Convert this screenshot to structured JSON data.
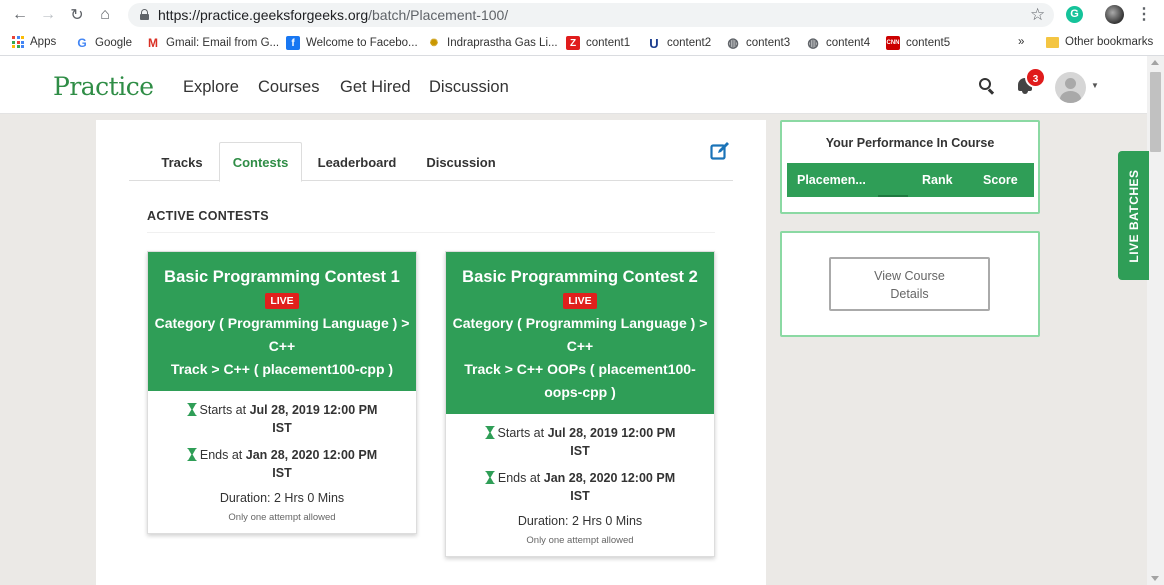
{
  "browser": {
    "url_host": "https://practice.geeksforgeeks.org",
    "url_path": "/batch/Placement-100/",
    "grammarly_letter": "G",
    "bookmarks": [
      {
        "label": "Apps",
        "icon": "apps-grid-icon"
      },
      {
        "label": "Google",
        "icon": "google-icon",
        "color": "#4285f4",
        "glyph": "G"
      },
      {
        "label": "Gmail: Email from G...",
        "icon": "gmail-icon",
        "color": "#d93025",
        "glyph": "M"
      },
      {
        "label": "Welcome to Facebo...",
        "icon": "facebook-icon",
        "color": "#1877f2",
        "glyph": "f"
      },
      {
        "label": "Indraprastha Gas Li...",
        "icon": "igl-icon",
        "color": "#f4b400",
        "glyph": "✺"
      },
      {
        "label": "content1",
        "icon": "content1-icon",
        "color": "#e01c1c",
        "glyph": "Z"
      },
      {
        "label": "content2",
        "icon": "content2-icon",
        "color": "#1a3c8e",
        "glyph": "U"
      },
      {
        "label": "content3",
        "icon": "globe-icon",
        "color": "#5f6368",
        "glyph": "◍"
      },
      {
        "label": "content4",
        "icon": "globe-icon",
        "color": "#5f6368",
        "glyph": "◍"
      },
      {
        "label": "content5",
        "icon": "cnn-icon",
        "color": "#cc0000",
        "glyph": "CNN"
      }
    ],
    "overflow_label": "»",
    "other_bookmarks": "Other bookmarks"
  },
  "header": {
    "logo": "Practice",
    "nav": [
      "Explore",
      "Courses",
      "Get Hired",
      "Discussion"
    ],
    "notification_count": "3"
  },
  "tabs": [
    "Tracks",
    "Contests",
    "Leaderboard",
    "Discussion"
  ],
  "active_tab": "Contests",
  "section_title": "ACTIVE CONTESTS",
  "contests": [
    {
      "title": "Basic Programming Contest 1",
      "badge": "LIVE",
      "category_lines": [
        "Category ( Programming Language ) >",
        "C++"
      ],
      "track_lines": [
        "Track > C++ ( placement100-cpp )"
      ],
      "starts_label": "Starts at",
      "starts_value": "Jul 28, 2019 12:00 PM",
      "starts_tz": "IST",
      "ends_label": "Ends at",
      "ends_value": "Jan 28, 2020 12:00 PM",
      "ends_tz": "IST",
      "duration": "Duration: 2 Hrs 0 Mins",
      "attempt_note": "Only one attempt allowed"
    },
    {
      "title": "Basic Programming Contest 2",
      "badge": "LIVE",
      "category_lines": [
        "Category ( Programming Language ) >",
        "C++"
      ],
      "track_lines": [
        "Track > C++ OOPs ( placement100-",
        "oops-cpp )"
      ],
      "starts_label": "Starts at",
      "starts_value": "Jul 28, 2019 12:00 PM",
      "starts_tz": "IST",
      "ends_label": "Ends at",
      "ends_value": "Jan 28, 2020 12:00 PM",
      "ends_tz": "IST",
      "duration": "Duration: 2 Hrs 0 Mins",
      "attempt_note": "Only one attempt allowed"
    }
  ],
  "performance": {
    "title": "Your Performance In Course",
    "columns": [
      "Placemen...",
      "Rank",
      "Score"
    ]
  },
  "course_button": {
    "line1": "View Course",
    "line2": "Details"
  },
  "live_batches": "LIVE  BATCHES",
  "colors": {
    "brand_green": "#2f8d46",
    "card_green": "#2f9e57",
    "live_red": "#e0201c",
    "panel_border": "#8bd9a3"
  }
}
